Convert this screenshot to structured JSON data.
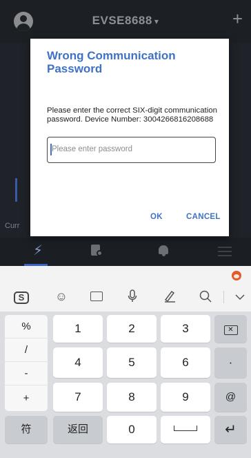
{
  "app": {
    "title": "EVSE8688",
    "title_caret": "▾",
    "add_label": "+",
    "cut_text": "Curr"
  },
  "tabs": [
    {
      "icon": "lightning-icon",
      "active": true
    },
    {
      "icon": "document-settings-icon",
      "active": false
    },
    {
      "icon": "bell-icon",
      "active": false
    },
    {
      "icon": "menu-icon",
      "active": false
    }
  ],
  "dialog": {
    "title": "Wrong Communication Password",
    "message": "Please enter the correct SIX-digit communication password. Device Number:  3004266816208688",
    "input_placeholder": "Please enter password",
    "ok_label": "OK",
    "cancel_label": "CANCEL"
  },
  "keyboard": {
    "toolbar": [
      "logo-icon",
      "emoji-icon",
      "keyboard-icon",
      "microphone-icon",
      "handwriting-icon",
      "search-icon",
      "chevron-down-icon"
    ],
    "side_keys": [
      "%",
      "/",
      "-",
      "+"
    ],
    "digits": [
      "1",
      "2",
      "3",
      "4",
      "5",
      "6",
      "7",
      "8",
      "9",
      "0"
    ],
    "right_keys": {
      "dot": "·",
      "at": "@"
    },
    "bottom": {
      "symbols": "符",
      "back": "返回"
    }
  },
  "colors": {
    "accent": "#3f72c6",
    "app_background": "#1f2329",
    "keyboard_background": "#dcdde0"
  }
}
